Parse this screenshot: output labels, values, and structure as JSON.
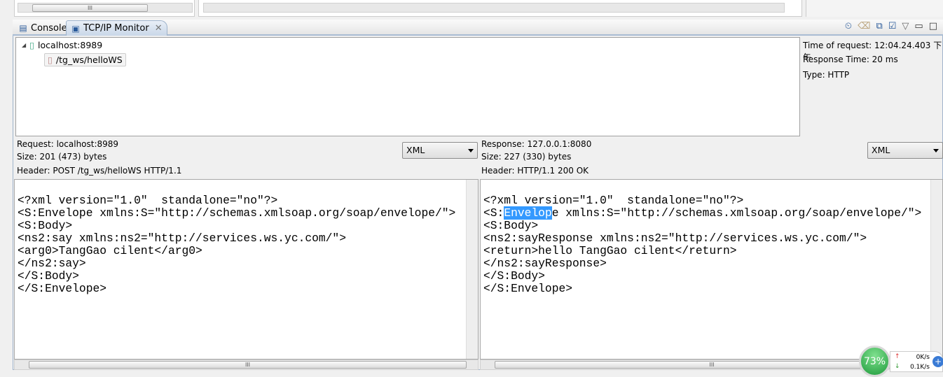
{
  "tabs": [
    {
      "label": "Console",
      "icon": "console-icon"
    },
    {
      "label": "TCP/IP Monitor",
      "icon": "tcpip-monitor-icon",
      "active": true
    }
  ],
  "toolbar_icons": [
    "sort-by-time-icon",
    "clear-icon",
    "properties-icon",
    "show-header-icon",
    "view-menu-icon",
    "minimize-icon",
    "maximize-icon"
  ],
  "tree": {
    "host": "localhost:8989",
    "request": "/tg_ws/helloWS"
  },
  "details": {
    "time": "Time of request: 12:04.24.403 下午",
    "response_time": "Response Time: 20 ms",
    "type": "Type: HTTP"
  },
  "request": {
    "host": "Request: localhost:8989",
    "size": "Size: 201 (473) bytes",
    "header": "Header: POST /tg_ws/helloWS HTTP/1.1",
    "format": "XML",
    "lines": [
      "<?xml version=\"1.0\"  standalone=\"no\"?>",
      "<S:Envelope xmlns:S=\"http://schemas.xmlsoap.org/soap/envelope/\">",
      "<S:Body>",
      "<ns2:say xmlns:ns2=\"http://services.ws.yc.com/\">",
      "<arg0>TangGao cilent</arg0>",
      "</ns2:say>",
      "</S:Body>",
      "</S:Envelope>"
    ]
  },
  "response": {
    "host": "Response: 127.0.0.1:8080",
    "size": "Size: 227 (330) bytes",
    "header": "Header: HTTP/1.1 200 OK",
    "format": "XML",
    "line1": "<?xml version=\"1.0\"  standalone=\"no\"?>",
    "line2_pre": "<S:",
    "line2_sel": "Envelop",
    "line2_post": "e xmlns:S=\"http://schemas.xmlsoap.org/soap/envelope/\">",
    "lines": [
      "<S:Body>",
      "<ns2:sayResponse xmlns:ns2=\"http://services.ws.yc.com/\">",
      "<return>hello TangGao cilent</return>",
      "</ns2:sayResponse>",
      "</S:Body>",
      "</S:Envelope>"
    ]
  },
  "network_widget": {
    "percent": "73%",
    "upload": "0K/s",
    "download": "0.1K/s"
  }
}
